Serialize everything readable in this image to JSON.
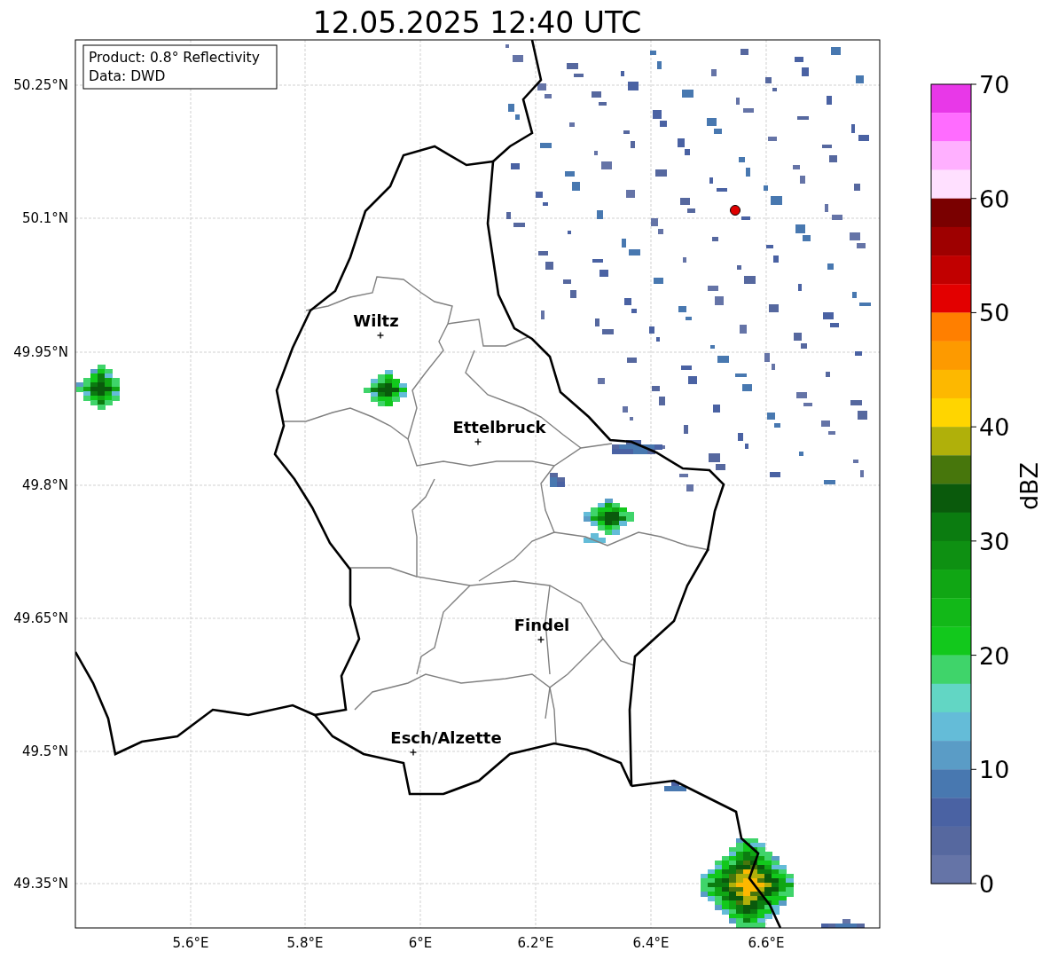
{
  "title": "12.05.2025 12:40 UTC",
  "info_box": {
    "lines": [
      "Product: 0.8° Reflectivity",
      "Data: DWD"
    ]
  },
  "cities": [
    {
      "name": "Wiltz"
    },
    {
      "name": "Ettelbruck"
    },
    {
      "name": "Findel"
    },
    {
      "name": "Esch/Alzette"
    }
  ],
  "lat_ticks": [
    "50.25°N",
    "50.1°N",
    "49.95°N",
    "49.8°N",
    "49.65°N",
    "49.5°N",
    "49.35°N"
  ],
  "lon_ticks": [
    "5.6°E",
    "5.8°E",
    "6°E",
    "6.2°E",
    "6.4°E",
    "6.6°E"
  ],
  "colorbar": {
    "label": "dBZ",
    "ticks": [
      "70",
      "60",
      "50",
      "40",
      "30",
      "20",
      "10",
      "0"
    ],
    "bands": [
      {
        "color": "#e838e8"
      },
      {
        "color": "#ff6cff"
      },
      {
        "color": "#ffb0ff"
      },
      {
        "color": "#ffe0ff"
      },
      {
        "color": "#7a0000"
      },
      {
        "color": "#9e0000"
      },
      {
        "color": "#c10000"
      },
      {
        "color": "#e30000"
      },
      {
        "color": "#ff7f00"
      },
      {
        "color": "#fd9a00"
      },
      {
        "color": "#fdb800"
      },
      {
        "color": "#ffd500"
      },
      {
        "color": "#b0b00a"
      },
      {
        "color": "#47760c"
      },
      {
        "color": "#0a5a0c"
      },
      {
        "color": "#0b7c10"
      },
      {
        "color": "#0e9012"
      },
      {
        "color": "#10a614"
      },
      {
        "color": "#12b818"
      },
      {
        "color": "#12c81c"
      },
      {
        "color": "#3fd46a"
      },
      {
        "color": "#62d6c4"
      },
      {
        "color": "#64bcd8"
      },
      {
        "color": "#5a9cc6"
      },
      {
        "color": "#4878b0"
      },
      {
        "color": "#4a62a3"
      },
      {
        "color": "#56689f"
      },
      {
        "color": "#6574a7"
      }
    ]
  }
}
